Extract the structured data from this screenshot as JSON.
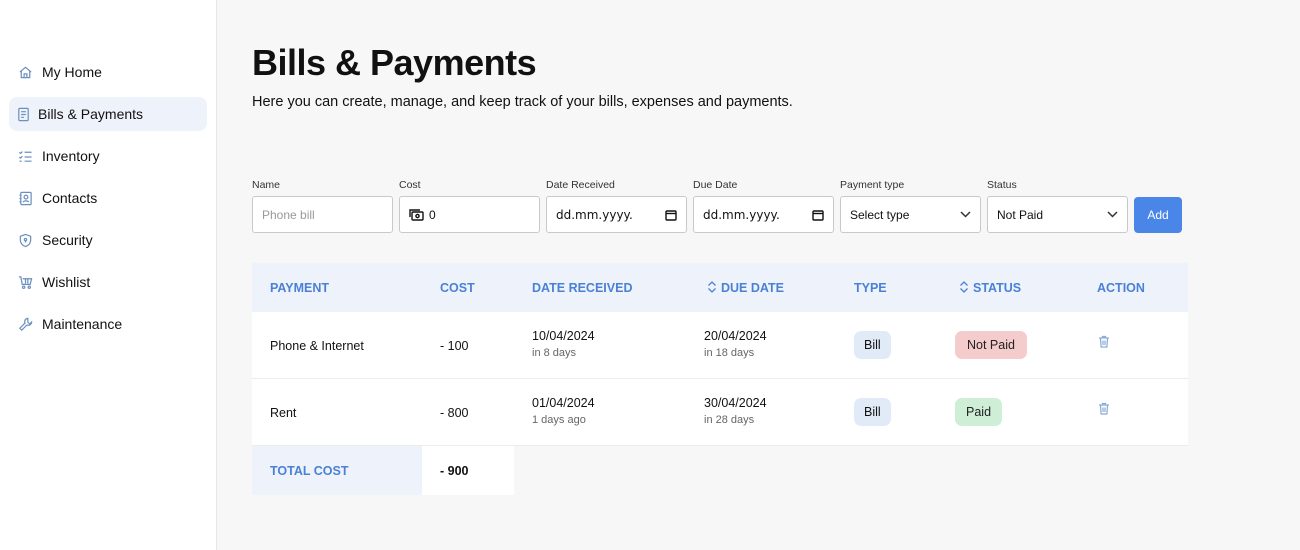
{
  "sidebar": {
    "items": [
      {
        "label": "My Home",
        "icon": "home-icon"
      },
      {
        "label": "Bills & Payments",
        "icon": "receipt-icon",
        "active": true
      },
      {
        "label": "Inventory",
        "icon": "checklist-icon"
      },
      {
        "label": "Contacts",
        "icon": "contact-card-icon"
      },
      {
        "label": "Security",
        "icon": "shield-icon"
      },
      {
        "label": "Wishlist",
        "icon": "gift-cart-icon"
      },
      {
        "label": "Maintenance",
        "icon": "wrench-icon"
      }
    ]
  },
  "header": {
    "title": "Bills & Payments",
    "subtitle": "Here you can create, manage, and keep track of your bills, expenses and payments."
  },
  "form": {
    "name": {
      "label": "Name",
      "placeholder": "Phone bill"
    },
    "cost": {
      "label": "Cost",
      "value": "0",
      "icon": "money-icon"
    },
    "date_received": {
      "label": "Date Received",
      "value": "dd.mm.yyyy."
    },
    "due_date": {
      "label": "Due Date",
      "value": "dd.mm.yyyy."
    },
    "payment_type": {
      "label": "Payment type",
      "value": "Select type"
    },
    "status": {
      "label": "Status",
      "value": "Not Paid"
    },
    "add_label": "Add"
  },
  "table": {
    "headers": {
      "payment": "PAYMENT",
      "cost": "COST",
      "date_received": "DATE RECEIVED",
      "due_date": "DUE DATE",
      "type": "TYPE",
      "status": "STATUS",
      "action": "ACTION"
    },
    "rows": [
      {
        "payment": "Phone & Internet",
        "cost": "- 100",
        "date_received": "10/04/2024",
        "date_received_rel": "in 8 days",
        "due_date": "20/04/2024",
        "due_date_rel": "in 18 days",
        "type": "Bill",
        "status": "Not Paid"
      },
      {
        "payment": "Rent",
        "cost": "- 800",
        "date_received": "01/04/2024",
        "date_received_rel": "1 days ago",
        "due_date": "30/04/2024",
        "due_date_rel": "in 28 days",
        "type": "Bill",
        "status": "Paid"
      }
    ],
    "total_label": "TOTAL COST",
    "total_value": "- 900"
  },
  "colors": {
    "accent": "#4a86e8",
    "header_text": "#4a80d6",
    "header_bg": "#eef3fb",
    "not_paid_bg": "#f4cccc",
    "paid_bg": "#cfeed6"
  }
}
